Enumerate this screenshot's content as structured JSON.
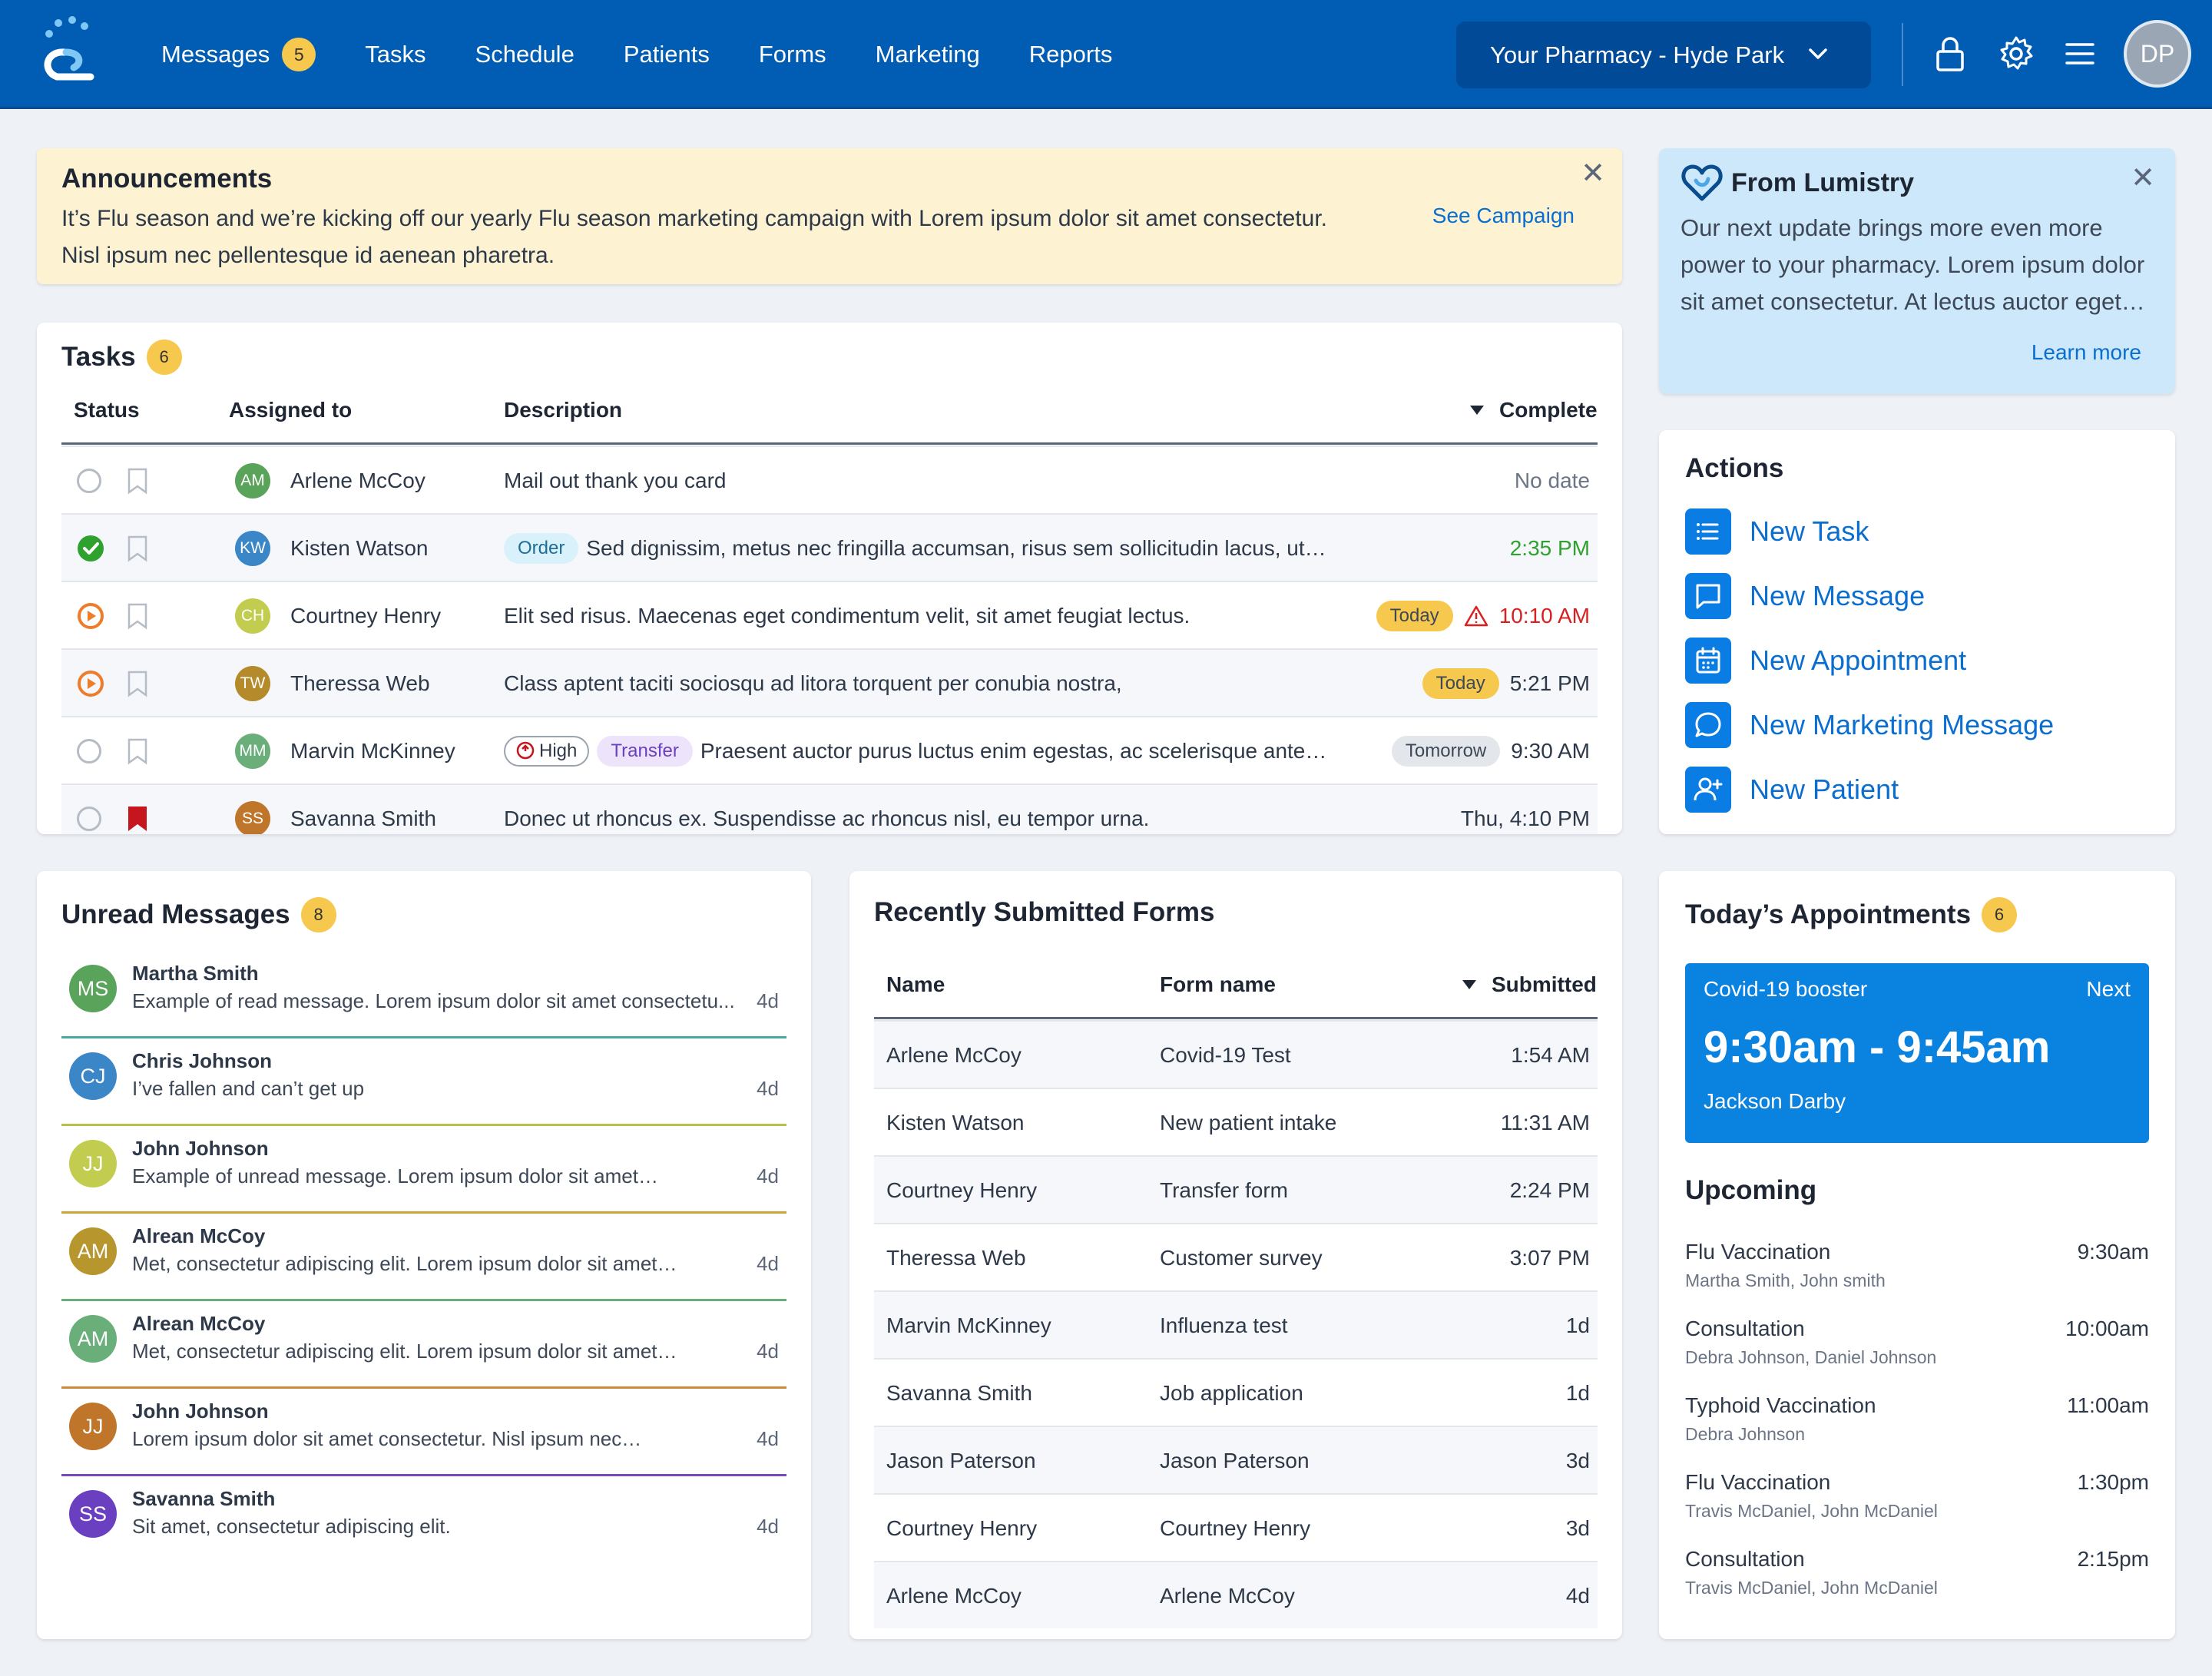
{
  "nav": {
    "items": [
      {
        "label": "Messages",
        "badge": "5"
      },
      {
        "label": "Tasks"
      },
      {
        "label": "Schedule"
      },
      {
        "label": "Patients"
      },
      {
        "label": "Forms"
      },
      {
        "label": "Marketing"
      },
      {
        "label": "Reports"
      }
    ],
    "pharmacy": "Your Pharmacy - Hyde Park",
    "avatar_initials": "DP",
    "icons": [
      "lock-icon",
      "gear-icon",
      "menu-icon"
    ]
  },
  "announcement": {
    "title": "Announcements",
    "text": "It’s Flu season and we’re kicking off our yearly Flu season marketing campaign with Lorem ipsum dolor sit amet consectetur. Nisl ipsum nec pellentesque id aenean pharetra.",
    "link": "See Campaign",
    "close": "✕"
  },
  "lumistry": {
    "title": "From Lumistry",
    "text": "Our next update brings more even more power to your pharmacy. Lorem ipsum dolor sit amet consectetur. At lectus auctor eget…",
    "link": "Learn more",
    "close": "✕"
  },
  "tasks": {
    "title": "Tasks",
    "count": "6",
    "headers": {
      "status": "Status",
      "assigned": "Assigned to",
      "description": "Description",
      "complete": "Complete"
    },
    "rows": [
      {
        "status": "open",
        "flag": false,
        "initials": "AM",
        "avatar_color": "#5aa35a",
        "name": "Arlene McCoy",
        "tags": [],
        "description": "Mail out thank you card",
        "chip": "",
        "warn": false,
        "time": "No date",
        "time_color": "#6b7585"
      },
      {
        "status": "done",
        "flag": false,
        "initials": "KW",
        "avatar_color": "#3b86c6",
        "name": "Kisten Watson",
        "tags": [
          {
            "label": "Order",
            "bg": "#d9f1fb",
            "fg": "#1f6e94"
          }
        ],
        "description": "Sed dignissim, metus nec fringilla accumsan, risus sem sollicitudin lacus, ut…",
        "chip": "",
        "warn": false,
        "time": "2:35 PM",
        "time_color": "#2ea12e"
      },
      {
        "status": "progress",
        "flag": false,
        "initials": "CH",
        "avatar_color": "#c2cc4e",
        "name": "Courtney Henry",
        "tags": [],
        "description": "Elit sed risus. Maecenas eget condimentum velit, sit amet feugiat lectus.",
        "chip": "Today",
        "chip_bg": "#f7c84e",
        "warn": true,
        "time": "10:10 AM",
        "time_color": "#d92020"
      },
      {
        "status": "progress",
        "flag": false,
        "initials": "TW",
        "avatar_color": "#b48a2a",
        "name": "Theressa Web",
        "tags": [],
        "description": "Class aptent taciti sociosqu ad litora torquent per conubia nostra,",
        "chip": "Today",
        "chip_bg": "#f7c84e",
        "warn": false,
        "time": "5:21 PM",
        "time_color": "#2d3848"
      },
      {
        "status": "open",
        "flag": false,
        "initials": "MM",
        "avatar_color": "#6aae7a",
        "name": "Marvin McKinney",
        "tags": [
          {
            "label": "High",
            "bg": "#ffffff",
            "fg": "#2d3848",
            "border": "#9aa3ae",
            "icon": true
          },
          {
            "label": "Transfer",
            "bg": "#ede4fb",
            "fg": "#6a3fc0"
          }
        ],
        "description": "Praesent auctor purus luctus enim egestas, ac scelerisque ante…",
        "chip": "Tomorrow",
        "chip_bg": "#e3e7ec",
        "warn": false,
        "time": "9:30 AM",
        "time_color": "#2d3848"
      },
      {
        "status": "open",
        "flag": true,
        "initials": "SS",
        "avatar_color": "#c0762a",
        "name": "Savanna Smith",
        "tags": [],
        "description": "Donec ut rhoncus ex. Suspendisse ac rhoncus nisl, eu tempor urna.",
        "chip": "",
        "warn": false,
        "time": "Thu, 4:10 PM",
        "time_color": "#2d3848"
      }
    ]
  },
  "actions": {
    "title": "Actions",
    "items": [
      {
        "label": "New Task",
        "icon": "list-icon"
      },
      {
        "label": "New Message",
        "icon": "chat-icon"
      },
      {
        "label": "New Appointment",
        "icon": "calendar-icon"
      },
      {
        "label": "New Marketing Message",
        "icon": "bubble-icon"
      },
      {
        "label": "New Patient",
        "icon": "add-user-icon"
      }
    ]
  },
  "messages": {
    "title": "Unread Messages",
    "count": "8",
    "items": [
      {
        "initials": "MS",
        "color": "#5aa35a",
        "name": "Martha Smith",
        "preview": "Example of read message. Lorem ipsum dolor sit amet consectetu...",
        "time": "4d",
        "line": "#4aa8a0"
      },
      {
        "initials": "CJ",
        "color": "#3b86c6",
        "name": "Chris Johnson",
        "preview": "I’ve fallen and can’t get up",
        "time": "4d",
        "line": "#b5c24e"
      },
      {
        "initials": "JJ",
        "color": "#c2cc4e",
        "name": "John Johnson",
        "preview": "Example of unread message. Lorem ipsum dolor sit amet…",
        "time": "4d",
        "line": "#c9a53a"
      },
      {
        "initials": "AM",
        "color": "#b8962e",
        "name": "Alrean McCoy",
        "preview": "Met, consectetur adipiscing elit. Lorem ipsum dolor sit amet…",
        "time": "4d",
        "line": "#6aae7a"
      },
      {
        "initials": "AM",
        "color": "#6aae7a",
        "name": "Alrean McCoy",
        "preview": "Met, consectetur adipiscing elit.  Lorem ipsum dolor sit amet…",
        "time": "4d",
        "line": "#d08a3a"
      },
      {
        "initials": "JJ",
        "color": "#c0762a",
        "name": "John Johnson",
        "preview": "Lorem ipsum dolor sit amet consectetur. Nisl ipsum nec…",
        "time": "4d",
        "line": "#7a4ab8"
      },
      {
        "initials": "SS",
        "color": "#6a3fc0",
        "name": "Savanna Smith",
        "preview": "Sit amet, consectetur adipiscing elit.",
        "time": "4d",
        "line": ""
      }
    ]
  },
  "forms": {
    "title": "Recently Submitted Forms",
    "headers": {
      "name": "Name",
      "form": "Form name",
      "submitted": "Submitted"
    },
    "rows": [
      {
        "name": "Arlene McCoy",
        "form": "Covid-19 Test",
        "submitted": "1:54 AM"
      },
      {
        "name": "Kisten Watson",
        "form": "New patient intake",
        "submitted": "11:31 AM"
      },
      {
        "name": "Courtney Henry",
        "form": "Transfer form",
        "submitted": "2:24 PM"
      },
      {
        "name": "Theressa Web",
        "form": "Customer survey",
        "submitted": "3:07 PM"
      },
      {
        "name": "Marvin McKinney",
        "form": "Influenza test",
        "submitted": "1d"
      },
      {
        "name": "Savanna Smith",
        "form": "Job application",
        "submitted": "1d"
      },
      {
        "name": "Jason Paterson",
        "form": "Jason Paterson",
        "submitted": "3d"
      },
      {
        "name": "Courtney Henry",
        "form": "Courtney Henry",
        "submitted": "3d"
      },
      {
        "name": "Arlene McCoy",
        "form": "Arlene McCoy",
        "submitted": "4d"
      }
    ]
  },
  "appointments": {
    "title": "Today’s Appointments",
    "count": "6",
    "next": {
      "service": "Covid-19 booster",
      "tag": "Next",
      "time": "9:30am - 9:45am",
      "patient": "Jackson Darby"
    },
    "upcoming_title": "Upcoming",
    "upcoming": [
      {
        "name": "Flu Vaccination",
        "time": "9:30am",
        "people": "Martha Smith, John smith"
      },
      {
        "name": "Consultation",
        "time": "10:00am",
        "people": "Debra Johnson, Daniel Johnson"
      },
      {
        "name": "Typhoid Vaccination",
        "time": "11:00am",
        "people": "Debra Johnson"
      },
      {
        "name": "Flu Vaccination",
        "time": "1:30pm",
        "people": "Travis McDaniel, John McDaniel"
      },
      {
        "name": "Consultation",
        "time": "2:15pm",
        "people": "Travis McDaniel, John McDaniel"
      }
    ]
  }
}
